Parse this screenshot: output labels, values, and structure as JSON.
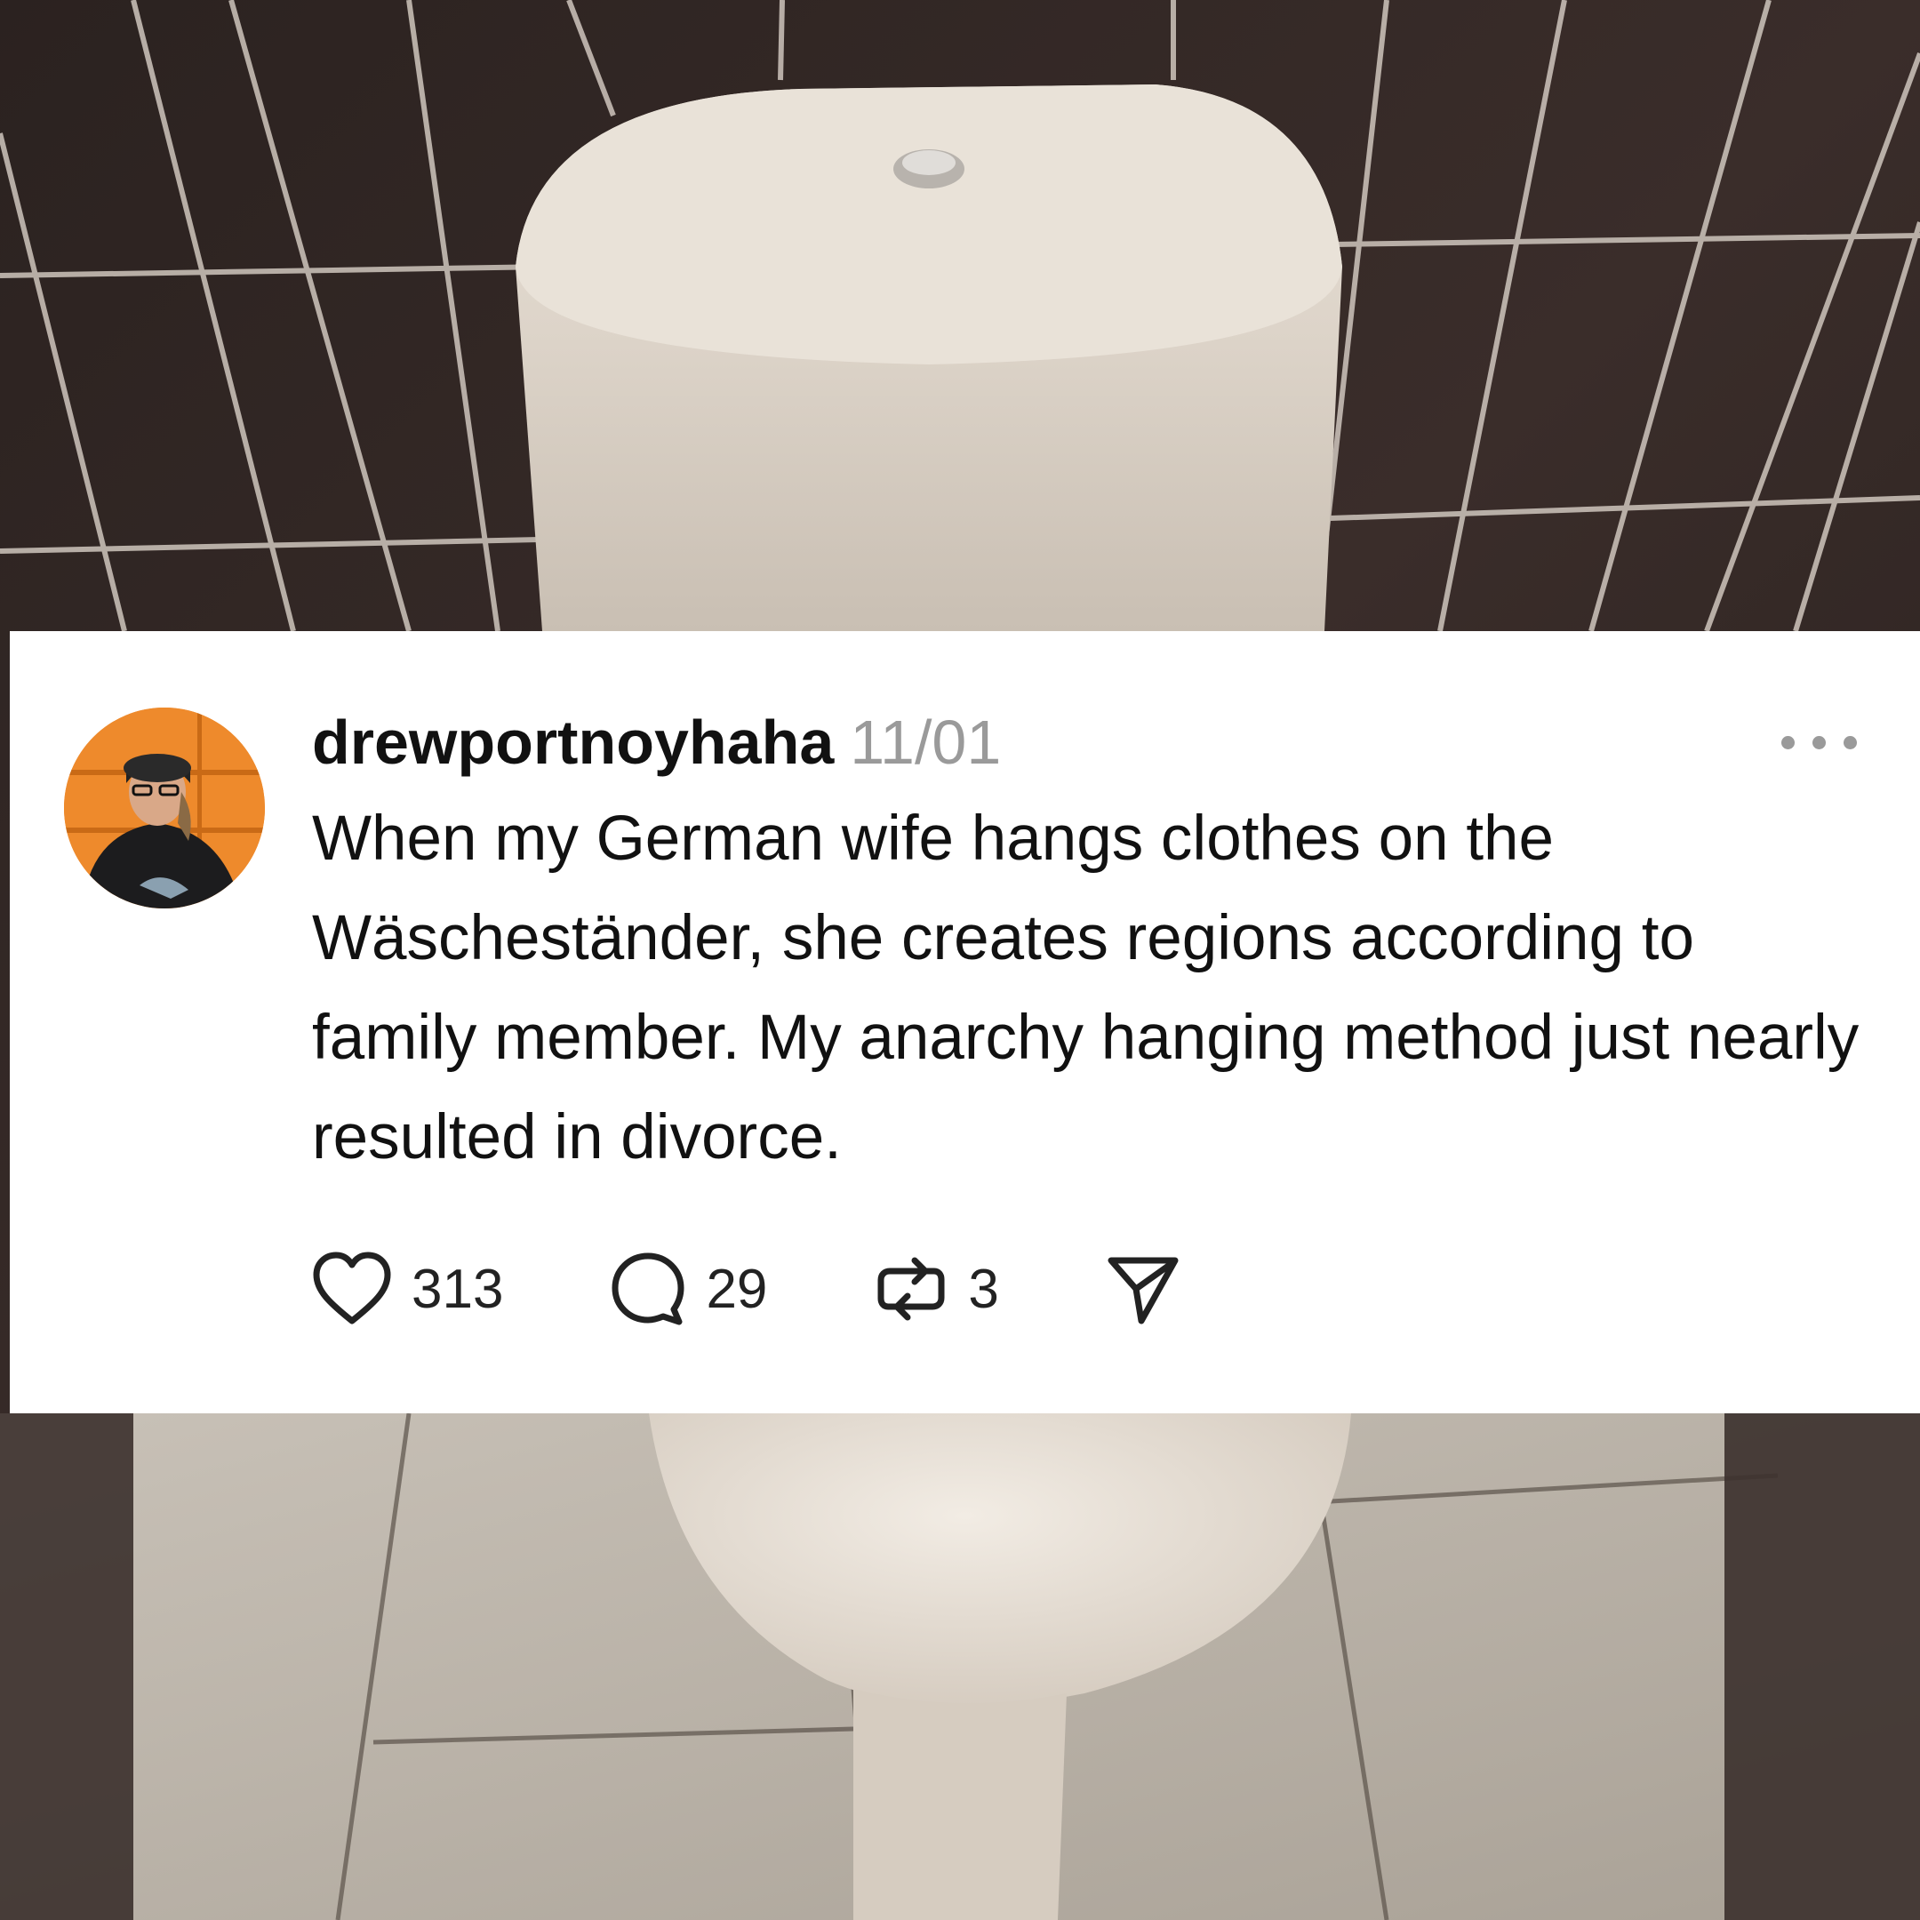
{
  "post": {
    "username": "drewportnoyhaha",
    "date": "11/01",
    "text": "When my German wife hangs clothes on the Wäscheständer, she creates regions according to family member. My anarchy hanging method just nearly resulted in divorce.",
    "likes": "313",
    "replies": "29",
    "reposts": "3"
  },
  "icons": {
    "like": "heart-icon",
    "reply": "speech-bubble-icon",
    "repost": "repost-arrows-icon",
    "share": "send-icon",
    "more": "more-dots-icon"
  },
  "colors": {
    "card_background": "#ffffff",
    "username": "#111111",
    "date": "#9a9a9a",
    "avatar_background": "#ee8a2c",
    "tile_background": "#2a211f",
    "toilet": "#d9d0c6",
    "floor": "#b9b2a8"
  }
}
